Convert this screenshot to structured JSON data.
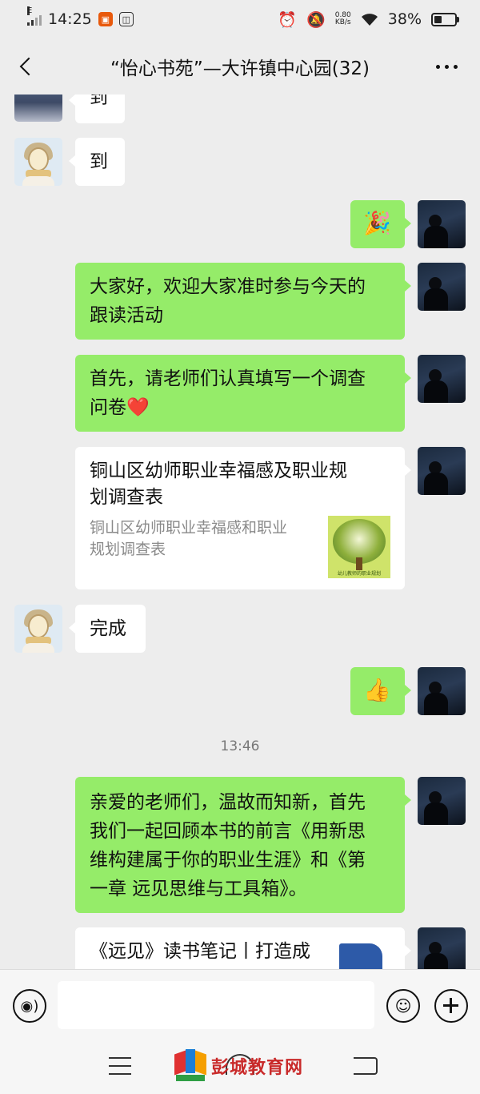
{
  "status_bar": {
    "network_type": "E",
    "time": "14:25",
    "speed_value": "0.80",
    "speed_unit": "KB/s",
    "battery_text": "38%",
    "battery_level": 0.38
  },
  "header": {
    "title": "“怡心书苑”—大许镇中心园(32)"
  },
  "messages": [
    {
      "side": "left",
      "type": "text",
      "text": "到"
    },
    {
      "side": "left",
      "type": "text",
      "text": "到"
    },
    {
      "side": "right",
      "type": "emoji",
      "text": "🎉"
    },
    {
      "side": "right",
      "type": "text",
      "lines": [
        "大家好，欢迎大家准时参与今天的",
        "跟读活动"
      ]
    },
    {
      "side": "right",
      "type": "text",
      "lines": [
        "首先，请老师们认真填写一个调查",
        "问卷❤️"
      ]
    },
    {
      "side": "right",
      "type": "card",
      "title_lines": [
        "铜山区幼师职业幸福感及职业规",
        "划调查表"
      ],
      "desc_lines": [
        "铜山区幼师职业幸福感和职业",
        "规划调查表"
      ],
      "thumb_caption": "幼儿教师的职业规划"
    },
    {
      "side": "left",
      "type": "text",
      "text": "完成"
    },
    {
      "side": "right",
      "type": "emoji",
      "text": "👍"
    },
    {
      "type": "timestamp",
      "text": "13:46"
    },
    {
      "side": "right",
      "type": "text",
      "lines": [
        "亲爱的老师们，温故而知新，首先",
        "我们一起回顾本书的前言《用新思",
        "维构建属于你的职业生涯》和《第",
        "一章 远见思维与工具箱》。"
      ]
    },
    {
      "side": "right",
      "type": "card",
      "title_lines": [
        "《远见》读书笔记丨打造成"
      ]
    }
  ],
  "input_bar": {
    "voice_icon": "voice-icon",
    "emoji_icon": "smiley-icon",
    "plus_icon": "plus-icon"
  },
  "watermark": {
    "text": "彭城教育网"
  },
  "colors": {
    "background": "#ededed",
    "bubble_green": "#95ec69",
    "bubble_white": "#ffffff"
  }
}
